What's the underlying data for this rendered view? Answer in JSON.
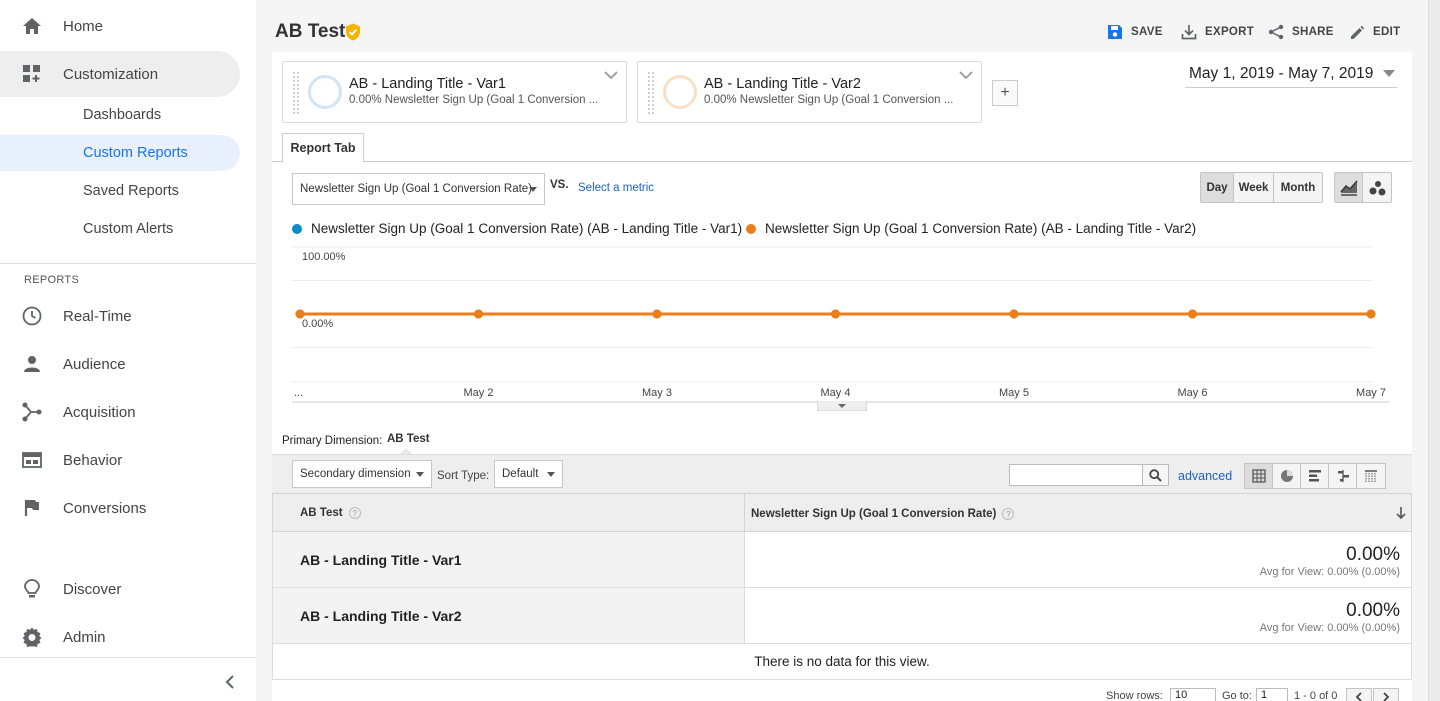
{
  "sidebar": {
    "home": {
      "label": "Home",
      "icon": "home-icon"
    },
    "customization": {
      "label": "Customization",
      "icon": "dashboard-customize-icon"
    },
    "sub_items": [
      {
        "label": "Dashboards"
      },
      {
        "label": "Custom Reports"
      },
      {
        "label": "Saved Reports"
      },
      {
        "label": "Custom Alerts"
      }
    ],
    "reports_heading": "REPORTS",
    "reports": [
      {
        "label": "Real-Time",
        "icon": "clock-icon"
      },
      {
        "label": "Audience",
        "icon": "person-icon"
      },
      {
        "label": "Acquisition",
        "icon": "acquisition-icon"
      },
      {
        "label": "Behavior",
        "icon": "behavior-icon"
      },
      {
        "label": "Conversions",
        "icon": "flag-icon"
      }
    ],
    "discover": {
      "label": "Discover",
      "icon": "lightbulb-icon"
    },
    "admin": {
      "label": "Admin",
      "icon": "gear-icon"
    }
  },
  "header": {
    "title": "AB Test",
    "save": "SAVE",
    "export": "EXPORT",
    "share": "SHARE",
    "edit": "EDIT"
  },
  "segments": [
    {
      "title": "AB - Landing Title - Var1",
      "subtitle": "0.00% Newsletter Sign Up (Goal 1 Conversion ...",
      "color": "#5fb3e0"
    },
    {
      "title": "AB - Landing Title - Var2",
      "subtitle": "0.00% Newsletter Sign Up (Goal 1 Conversion ...",
      "color": "#f5b97a"
    }
  ],
  "add_segment": "+",
  "date_range": "May 1, 2019 - May 7, 2019",
  "tab": {
    "label": "Report Tab"
  },
  "metric_select": "Newsletter Sign Up (Goal 1 Conversion Rate)",
  "vs": "VS.",
  "select_metric": "Select a metric",
  "granularity": {
    "day": "Day",
    "week": "Week",
    "month": "Month",
    "selected": "Day"
  },
  "legend": [
    {
      "label": "Newsletter Sign Up (Goal 1 Conversion Rate) (AB - Landing Title - Var1)",
      "color": "#058dc7"
    },
    {
      "label": "Newsletter Sign Up (Goal 1 Conversion Rate) (AB - Landing Title - Var2)",
      "color": "#ed7e17"
    }
  ],
  "chart_data": {
    "type": "line",
    "x": [
      "...",
      "May 2",
      "May 3",
      "May 4",
      "May 5",
      "May 6",
      "May 7"
    ],
    "series": [
      {
        "name": "Newsletter Sign Up (Goal 1 Conversion Rate) (AB - Landing Title - Var1)",
        "values": [
          0,
          0,
          0,
          0,
          0,
          0,
          0
        ],
        "color": "#058dc7"
      },
      {
        "name": "Newsletter Sign Up (Goal 1 Conversion Rate) (AB - Landing Title - Var2)",
        "values": [
          0,
          0,
          0,
          0,
          0,
          0,
          0
        ],
        "color": "#ed7e17"
      }
    ],
    "y_ticks": [
      "100.00%",
      "0.00%"
    ],
    "ylim": [
      0,
      100
    ],
    "grid": true
  },
  "primary_dimension": {
    "label": "Primary Dimension:",
    "value": "AB Test"
  },
  "table_toolbar": {
    "secondary_dimension": "Secondary dimension",
    "sort_type_label": "Sort Type:",
    "sort_type_value": "Default",
    "search_value": "",
    "advanced": "advanced"
  },
  "table": {
    "columns": [
      "AB Test",
      "Newsletter Sign Up (Goal 1 Conversion Rate)"
    ],
    "rows": [
      {
        "name": "AB - Landing Title - Var1",
        "value": "0.00%",
        "avg": "Avg for View: 0.00% (0.00%)"
      },
      {
        "name": "AB - Landing Title - Var2",
        "value": "0.00%",
        "avg": "Avg for View: 0.00% (0.00%)"
      }
    ],
    "no_data": "There is no data for this view."
  },
  "pagination": {
    "show_rows_label": "Show rows:",
    "show_rows_value": "10",
    "goto_label": "Go to:",
    "goto_value": "1",
    "range": "1 - 0 of 0"
  }
}
